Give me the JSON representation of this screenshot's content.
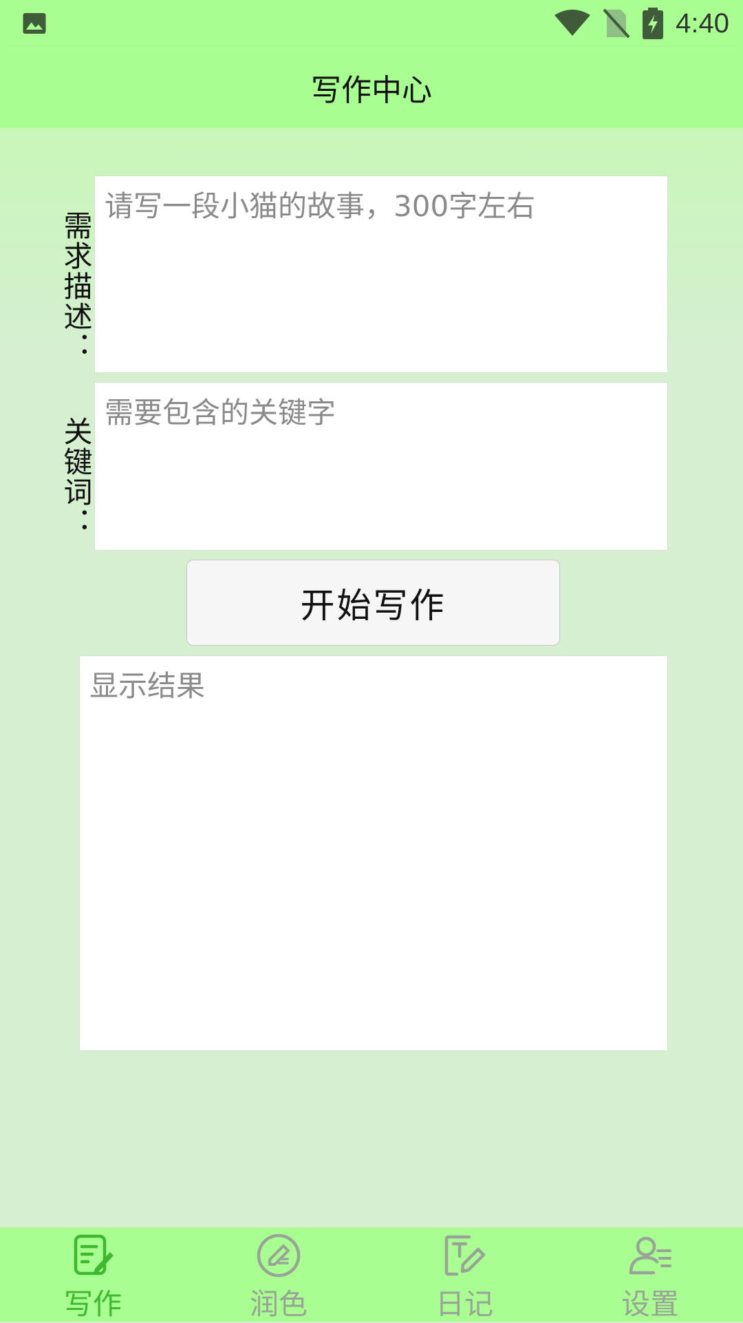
{
  "status_bar": {
    "time": "4:40",
    "icons": [
      "gallery-icon",
      "wifi-icon",
      "no-sim-icon",
      "battery-charging-icon"
    ]
  },
  "header": {
    "title": "写作中心"
  },
  "form": {
    "description_label": "需求描述：",
    "description_placeholder": "请写一段小猫的故事，300字左右",
    "keywords_label": "关键词：",
    "keywords_placeholder": "需要包含的关键字",
    "start_button": "开始写作",
    "result_placeholder": "显示结果"
  },
  "bottom_nav": {
    "items": [
      {
        "label": "写作",
        "icon": "write-doc-icon",
        "active": true
      },
      {
        "label": "润色",
        "icon": "polish-circle-icon",
        "active": false
      },
      {
        "label": "日记",
        "icon": "diary-icon",
        "active": false
      },
      {
        "label": "设置",
        "icon": "user-settings-icon",
        "active": false
      }
    ]
  },
  "colors": {
    "bar_green": "#a9fe92",
    "active_green": "#3db82f",
    "inactive_gray": "#9aa397"
  }
}
